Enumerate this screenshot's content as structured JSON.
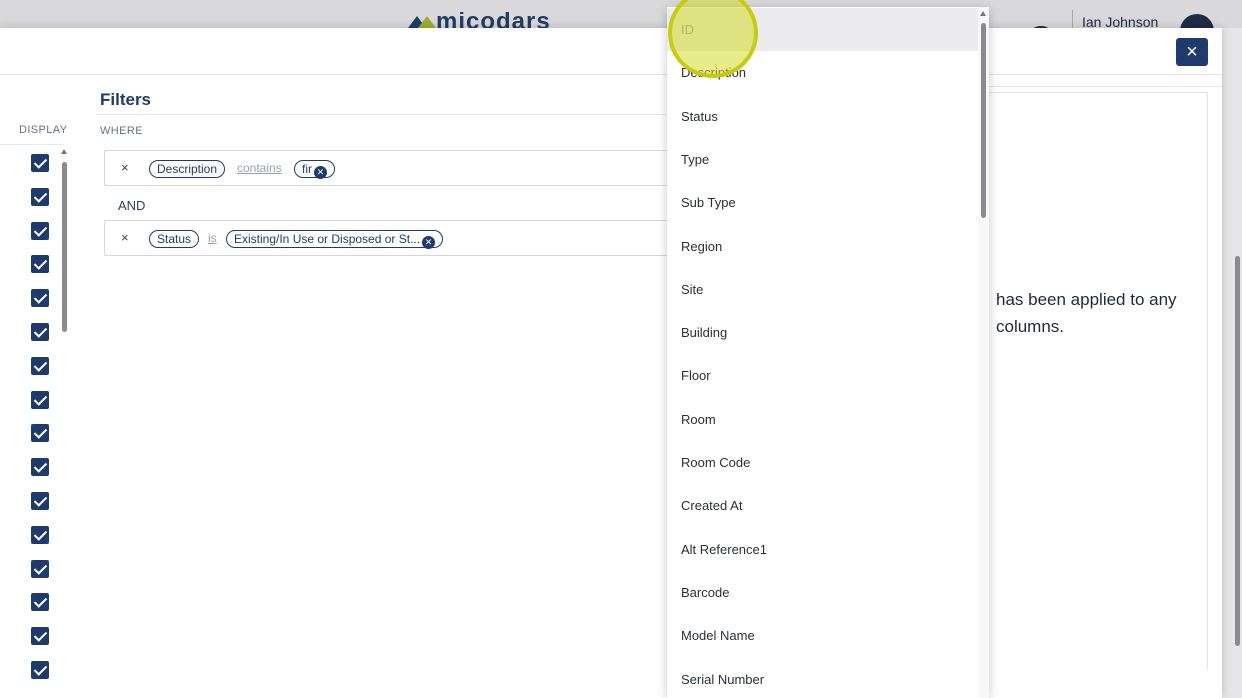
{
  "app": {
    "logo_text": "micodars",
    "user_name": "Ian Johnson"
  },
  "modal": {
    "close_label": "×",
    "display_header": "DISPLAY",
    "filters_title": "Filters",
    "where_label": "WHERE",
    "conjunction": "AND",
    "filters": [
      {
        "remove": "×",
        "field": "Description",
        "operator": "contains",
        "value": "fir"
      },
      {
        "remove": "×",
        "field": "Status",
        "operator": "is",
        "value": "Existing/In Use or Disposed or St..."
      }
    ],
    "empty_message_line1": "has been applied to any",
    "empty_message_line2": "columns.",
    "display_checkboxes": 16
  },
  "dropdown": {
    "options": [
      "ID",
      "Description",
      "Status",
      "Type",
      "Sub Type",
      "Region",
      "Site",
      "Building",
      "Floor",
      "Room",
      "Room Code",
      "Created At",
      "Alt Reference1",
      "Barcode",
      "Model Name",
      "Serial Number"
    ],
    "selected": "ID"
  },
  "colors": {
    "brand": "#1f3b6e",
    "highlight": "#d6da28"
  }
}
